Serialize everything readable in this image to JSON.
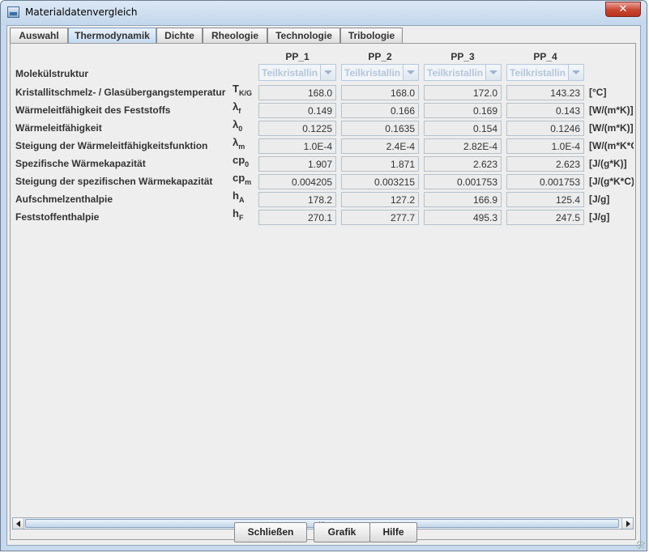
{
  "window": {
    "title": "Materialdatenvergleich",
    "close_label": "✕"
  },
  "tabs": [
    {
      "label": "Auswahl",
      "active": false
    },
    {
      "label": "Thermodynamik",
      "active": true
    },
    {
      "label": "Dichte",
      "active": false
    },
    {
      "label": "Rheologie",
      "active": false
    },
    {
      "label": "Technologie",
      "active": false
    },
    {
      "label": "Tribologie",
      "active": false
    }
  ],
  "columns": [
    "PP_1",
    "PP_2",
    "PP_3",
    "PP_4"
  ],
  "molekuelstruktur": {
    "label": "Molekülstruktur",
    "values": [
      "Teilkristallin",
      "Teilkristallin",
      "Teilkristallin",
      "Teilkristallin"
    ]
  },
  "rows": [
    {
      "label": "Kristallitschmelz- / Glasübergangstemperatur",
      "symbol": "T",
      "sub": "K/G",
      "values": [
        "168.0",
        "168.0",
        "172.0",
        "143.23"
      ],
      "unit": "[°C]"
    },
    {
      "label": "Wärmeleitfähigkeit des Feststoffs",
      "symbol": "λ",
      "sub": "f",
      "values": [
        "0.149",
        "0.166",
        "0.169",
        "0.143"
      ],
      "unit": "[W/(m*K)]"
    },
    {
      "label": "Wärmeleitfähigkeit",
      "symbol": "λ",
      "sub": "0",
      "values": [
        "0.1225",
        "0.1635",
        "0.154",
        "0.1246"
      ],
      "unit": "[W/(m*K)]"
    },
    {
      "label": "Steigung der Wärmeleitfähigkeitsfunktion",
      "symbol": "λ",
      "sub": "m",
      "values": [
        "1.0E-4",
        "2.4E-4",
        "2.82E-4",
        "1.0E-4"
      ],
      "unit": "[W/(m*K*C)]"
    },
    {
      "label": "Spezifische Wärmekapazität",
      "symbol": "cp",
      "sub": "0",
      "values": [
        "1.907",
        "1.871",
        "2.623",
        "2.623"
      ],
      "unit": "[J/(g*K)]"
    },
    {
      "label": "Steigung der spezifischen Wärmekapazität",
      "symbol": "cp",
      "sub": "m",
      "values": [
        "0.004205",
        "0.003215",
        "0.001753",
        "0.001753"
      ],
      "unit": "[J/(g*K*C)]"
    },
    {
      "label": "Aufschmelzenthalpie",
      "symbol": "h",
      "sub": "A",
      "values": [
        "178.2",
        "127.2",
        "166.9",
        "125.4"
      ],
      "unit": "[J/g]"
    },
    {
      "label": "Feststoffenthalpie",
      "symbol": "h",
      "sub": "F",
      "values": [
        "270.1",
        "277.7",
        "495.3",
        "247.5"
      ],
      "unit": "[J/g]"
    }
  ],
  "buttons": {
    "close": "Schließen",
    "chart": "Grafik",
    "help": "Hilfe"
  },
  "colors": {
    "active_tab": "#c4daf0",
    "title_bar": "#c7d9ee",
    "close_button": "#c9452f"
  }
}
